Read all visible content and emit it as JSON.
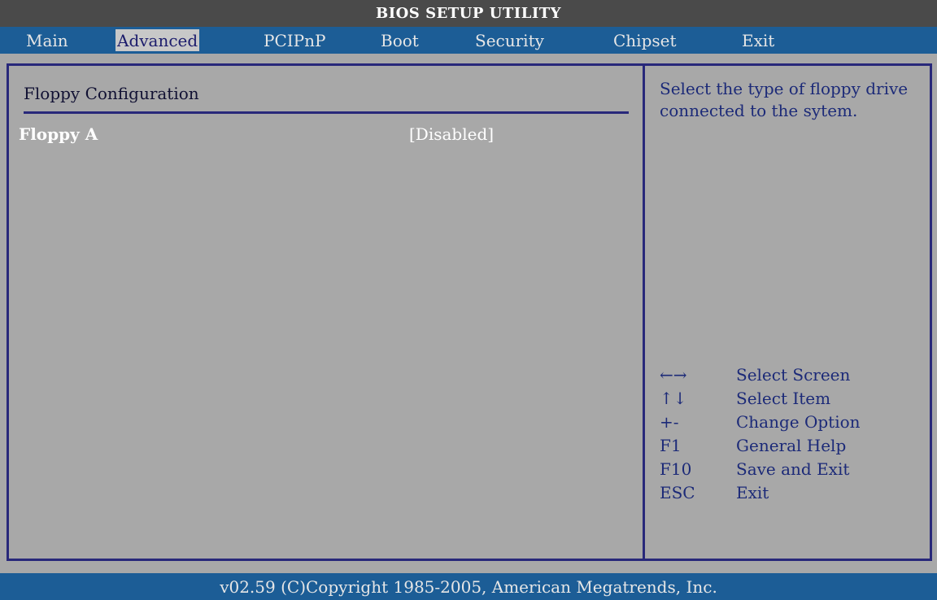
{
  "title": "BIOS SETUP UTILITY",
  "tabs": [
    {
      "label": "Main"
    },
    {
      "label": "Advanced"
    },
    {
      "label": "PCIPnP"
    },
    {
      "label": "Boot"
    },
    {
      "label": "Security"
    },
    {
      "label": "Chipset"
    },
    {
      "label": "Exit"
    }
  ],
  "active_tab": "Advanced",
  "section_title": "Floppy Configuration",
  "option": {
    "label": "Floppy A",
    "value": "[Disabled]"
  },
  "help": "Select the type of floppy drive connected to the sytem.",
  "keys": [
    {
      "key": "←→",
      "desc": "Select Screen"
    },
    {
      "key": "↑↓",
      "desc": "Select Item"
    },
    {
      "key": "+-",
      "desc": "Change Option"
    },
    {
      "key": "F1",
      "desc": "General Help"
    },
    {
      "key": "F10",
      "desc": "Save and Exit"
    },
    {
      "key": "ESC",
      "desc": "Exit"
    }
  ],
  "footer": "v02.59 (C)Copyright 1985-2005, American Megatrends, Inc.",
  "colors": {
    "title_bg": "#4a4a4a",
    "menu_bg": "#1c5d96",
    "body_bg": "#a8a8a8",
    "border": "#28287a",
    "help_text": "#1c2a78"
  }
}
